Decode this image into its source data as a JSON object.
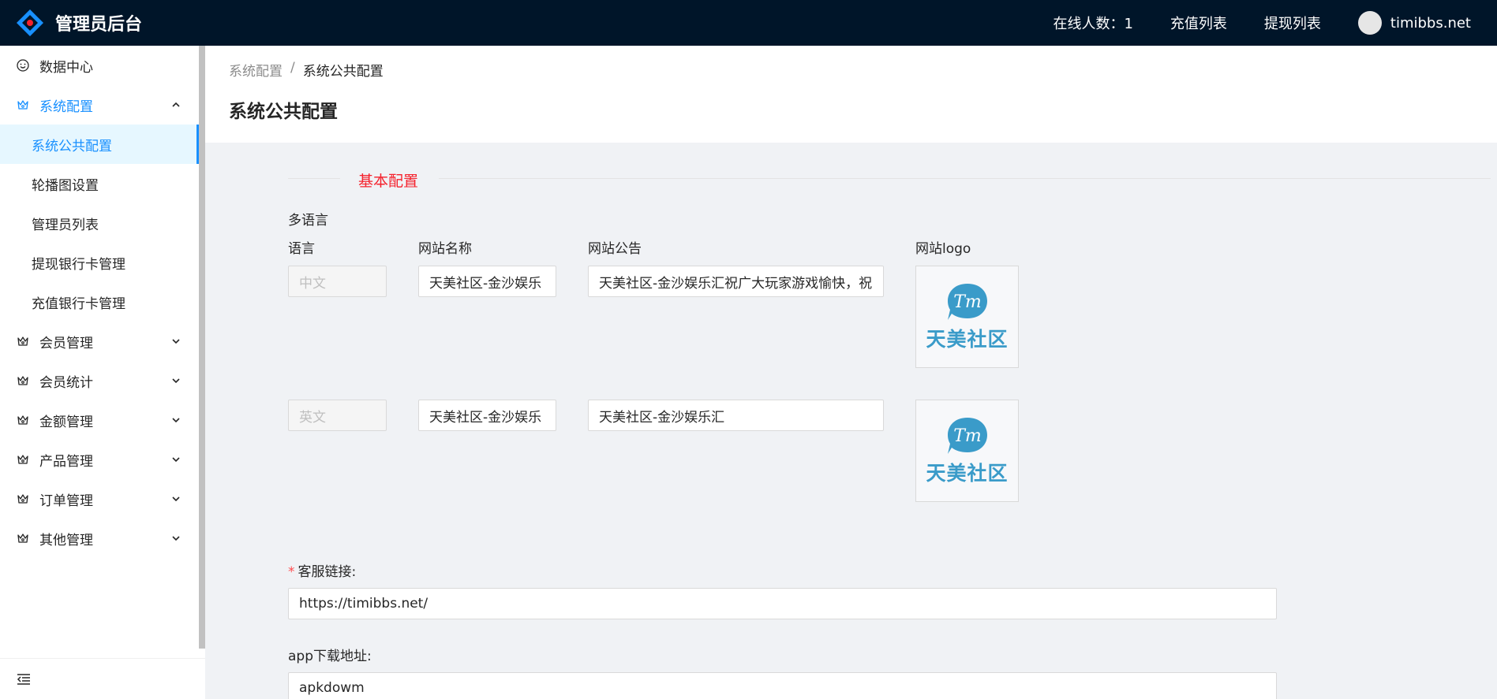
{
  "header": {
    "app_title": "管理员后台",
    "online_label": "在线人数：1",
    "recharge_link": "充值列表",
    "withdraw_link": "提现列表",
    "username": "timibbs.net"
  },
  "sidebar": {
    "items": [
      {
        "label": "数据中心",
        "icon": "smile-icon"
      },
      {
        "label": "系统配置",
        "icon": "crown-icon",
        "expanded": true
      },
      {
        "label": "会员管理",
        "icon": "crown-icon"
      },
      {
        "label": "会员统计",
        "icon": "crown-icon"
      },
      {
        "label": "金额管理",
        "icon": "crown-icon"
      },
      {
        "label": "产品管理",
        "icon": "crown-icon"
      },
      {
        "label": "订单管理",
        "icon": "crown-icon"
      },
      {
        "label": "其他管理",
        "icon": "crown-icon"
      }
    ],
    "sub_items": [
      {
        "label": "系统公共配置",
        "selected": true
      },
      {
        "label": "轮播图设置"
      },
      {
        "label": "管理员列表"
      },
      {
        "label": "提现银行卡管理"
      },
      {
        "label": "充值银行卡管理"
      }
    ]
  },
  "breadcrumb": {
    "parent": "系统配置",
    "separator": "/",
    "current": "系统公共配置"
  },
  "page_title": "系统公共配置",
  "form": {
    "section_title": "基本配置",
    "multilang_label": "多语言",
    "columns": {
      "language": "语言",
      "site_name": "网站名称",
      "notice": "网站公告",
      "logo": "网站logo"
    },
    "rows": [
      {
        "language": "中文",
        "site_name": "天美社区-金沙娱乐",
        "notice": "天美社区-金沙娱乐汇祝广大玩家游戏愉快，祝",
        "logo_text": "天美社区"
      },
      {
        "language": "英文",
        "site_name": "天美社区-金沙娱乐",
        "notice": "天美社区-金沙娱乐汇",
        "logo_text": "天美社区"
      }
    ],
    "customer_service_label": "客服链接:",
    "customer_service_required": "*",
    "customer_service_value": "https://timibbs.net/",
    "app_download_label": "app下载地址:",
    "app_download_value": "apkdowm"
  },
  "colors": {
    "header_bg": "#001529",
    "accent": "#1890ff",
    "section_title": "#f5222d",
    "logo_blue": "#3a9bc9"
  }
}
